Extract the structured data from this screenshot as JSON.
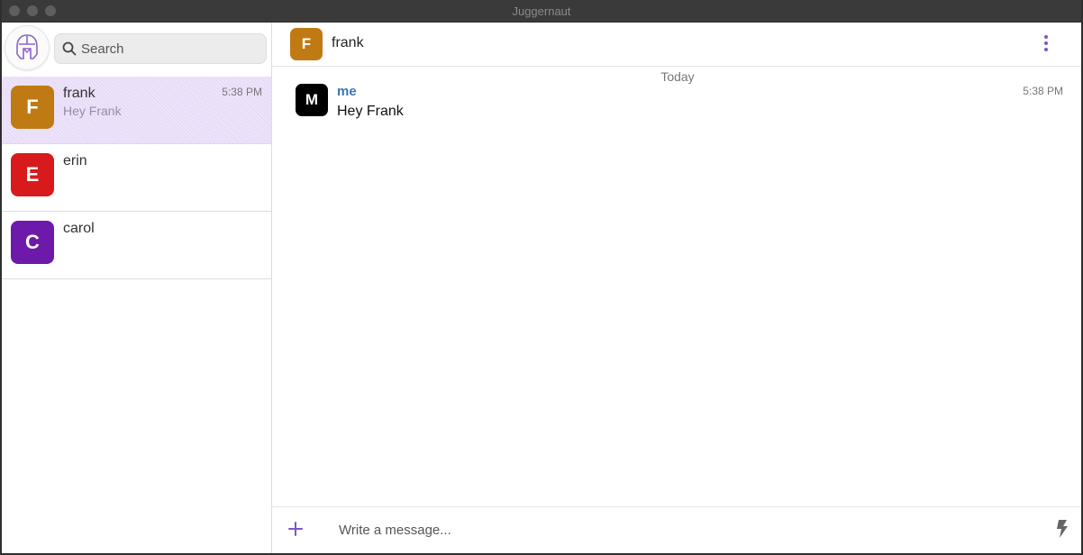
{
  "window": {
    "title": "Juggernaut"
  },
  "colors": {
    "accent": "#7f57c4",
    "author_link": "#3f76b4",
    "active_row": "#e8dcf8"
  },
  "sidebar": {
    "logo_icon": "helmet-logo-icon",
    "search": {
      "placeholder": "Search",
      "value": ""
    },
    "chats": [
      {
        "initial": "F",
        "name": "frank",
        "preview": "Hey Frank",
        "time": "5:38 PM",
        "color": "#c07a13",
        "active": true
      },
      {
        "initial": "E",
        "name": "erin",
        "preview": "",
        "time": "",
        "color": "#d81a1c",
        "active": false
      },
      {
        "initial": "C",
        "name": "carol",
        "preview": "",
        "time": "",
        "color": "#6d19a9",
        "active": false
      }
    ]
  },
  "conversation": {
    "header": {
      "initial": "F",
      "name": "frank",
      "color": "#c07a13",
      "menu_icon": "kebab-menu-icon"
    },
    "day_label": "Today",
    "messages": [
      {
        "initial": "M",
        "author": "me",
        "text": "Hey Frank",
        "time": "5:38 PM",
        "color": "#000000"
      }
    ],
    "composer": {
      "placeholder": "Write a message...",
      "value": "",
      "attach_icon": "plus-icon",
      "action_icon": "lightning-bolt-icon"
    }
  }
}
